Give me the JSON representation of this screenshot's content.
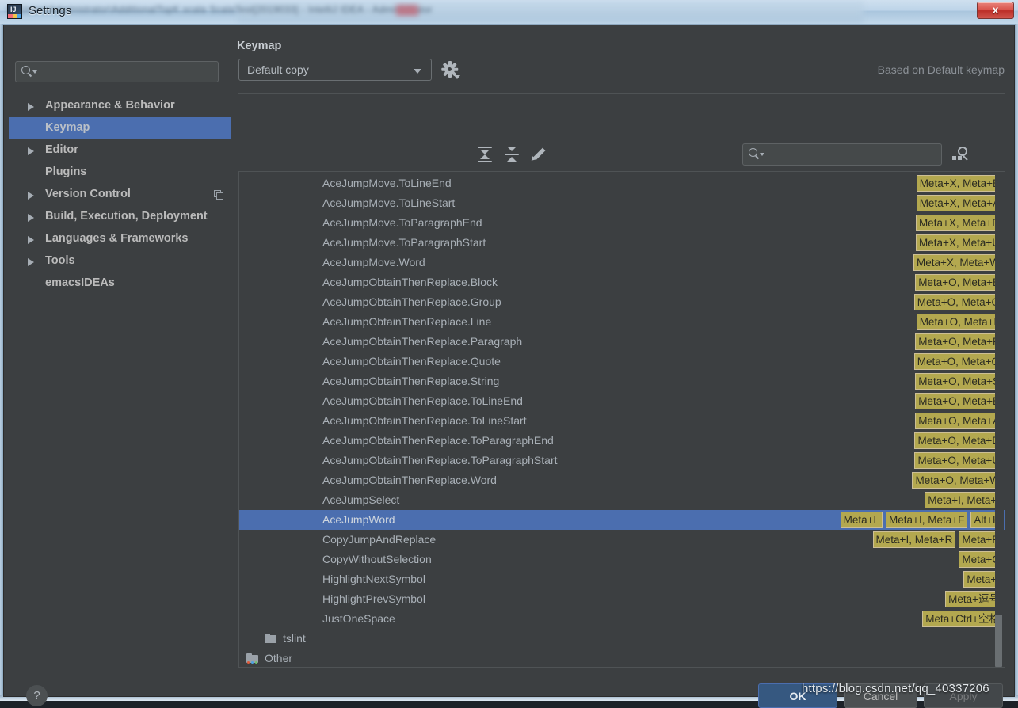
{
  "window": {
    "title": "Settings",
    "app_icon": "intellij-idea-icon",
    "blurred_title_text": "C:\\Users\\Administrator\\AdditionalTopK.scala ScalaTest[2019033] - IntelliJ IDEA - Administrator",
    "close_label": "x"
  },
  "sidebar": {
    "search_placeholder": "",
    "items": [
      {
        "label": "Appearance & Behavior",
        "expandable": true,
        "selected": false,
        "trailing_icon": ""
      },
      {
        "label": "Keymap",
        "expandable": false,
        "selected": true,
        "trailing_icon": ""
      },
      {
        "label": "Editor",
        "expandable": true,
        "selected": false,
        "trailing_icon": ""
      },
      {
        "label": "Plugins",
        "expandable": false,
        "selected": false,
        "trailing_icon": ""
      },
      {
        "label": "Version Control",
        "expandable": true,
        "selected": false,
        "trailing_icon": "copy-icon"
      },
      {
        "label": "Build, Execution, Deployment",
        "expandable": true,
        "selected": false,
        "trailing_icon": ""
      },
      {
        "label": "Languages & Frameworks",
        "expandable": true,
        "selected": false,
        "trailing_icon": ""
      },
      {
        "label": "Tools",
        "expandable": true,
        "selected": false,
        "trailing_icon": ""
      },
      {
        "label": "emacsIDEAs",
        "expandable": false,
        "selected": false,
        "trailing_icon": ""
      }
    ]
  },
  "main": {
    "title": "Keymap",
    "keymap_selected": "Default copy",
    "based_on": "Based on Default keymap",
    "search_placeholder": "",
    "toolbar": {
      "expand_all": "Expand All",
      "collapse_all": "Collapse All",
      "edit": "Edit Shortcut"
    },
    "rows": [
      {
        "name": "AceJumpMove.ToLineEnd",
        "indent": 105,
        "badges": [
          "Meta+X, Meta+E"
        ]
      },
      {
        "name": "AceJumpMove.ToLineStart",
        "indent": 105,
        "badges": [
          "Meta+X, Meta+A"
        ]
      },
      {
        "name": "AceJumpMove.ToParagraphEnd",
        "indent": 105,
        "badges": [
          "Meta+X, Meta+D"
        ]
      },
      {
        "name": "AceJumpMove.ToParagraphStart",
        "indent": 105,
        "badges": [
          "Meta+X, Meta+U"
        ]
      },
      {
        "name": "AceJumpMove.Word",
        "indent": 105,
        "badges": [
          "Meta+X, Meta+W"
        ]
      },
      {
        "name": "AceJumpObtainThenReplace.Block",
        "indent": 105,
        "badges": [
          "Meta+O, Meta+B"
        ]
      },
      {
        "name": "AceJumpObtainThenReplace.Group",
        "indent": 105,
        "badges": [
          "Meta+O, Meta+G"
        ]
      },
      {
        "name": "AceJumpObtainThenReplace.Line",
        "indent": 105,
        "badges": [
          "Meta+O, Meta+L"
        ]
      },
      {
        "name": "AceJumpObtainThenReplace.Paragraph",
        "indent": 105,
        "badges": [
          "Meta+O, Meta+P"
        ]
      },
      {
        "name": "AceJumpObtainThenReplace.Quote",
        "indent": 105,
        "badges": [
          "Meta+O, Meta+Q"
        ]
      },
      {
        "name": "AceJumpObtainThenReplace.String",
        "indent": 105,
        "badges": [
          "Meta+O, Meta+S"
        ]
      },
      {
        "name": "AceJumpObtainThenReplace.ToLineEnd",
        "indent": 105,
        "badges": [
          "Meta+O, Meta+E"
        ]
      },
      {
        "name": "AceJumpObtainThenReplace.ToLineStart",
        "indent": 105,
        "badges": [
          "Meta+O, Meta+A"
        ]
      },
      {
        "name": "AceJumpObtainThenReplace.ToParagraphEnd",
        "indent": 105,
        "badges": [
          "Meta+O, Meta+D"
        ]
      },
      {
        "name": "AceJumpObtainThenReplace.ToParagraphStart",
        "indent": 105,
        "badges": [
          "Meta+O, Meta+U"
        ]
      },
      {
        "name": "AceJumpObtainThenReplace.Word",
        "indent": 105,
        "badges": [
          "Meta+O, Meta+W"
        ]
      },
      {
        "name": "AceJumpSelect",
        "indent": 105,
        "badges": [
          "Meta+I, Meta+I"
        ]
      },
      {
        "name": "AceJumpWord",
        "indent": 105,
        "badges": [
          "Meta+L",
          "Meta+I, Meta+F",
          "Alt+K"
        ],
        "selected": true
      },
      {
        "name": "CopyJumpAndReplace",
        "indent": 105,
        "badges": [
          "Meta+I, Meta+R",
          "Meta+R"
        ]
      },
      {
        "name": "CopyWithoutSelection",
        "indent": 105,
        "badges": [
          "Meta+C"
        ]
      },
      {
        "name": "HighlightNextSymbol",
        "indent": 105,
        "badges": [
          "Meta+."
        ]
      },
      {
        "name": "HighlightPrevSymbol",
        "indent": 105,
        "badges": [
          "Meta+逗号"
        ]
      },
      {
        "name": "JustOneSpace",
        "indent": 105,
        "badges": [
          "Meta+Ctrl+空格"
        ]
      },
      {
        "name": "tslint",
        "indent": 55,
        "badges": [],
        "group": true,
        "icon": "folder-icon",
        "triangle_x": 33
      },
      {
        "name": "Other",
        "indent": 32,
        "badges": [],
        "group": true,
        "icon": "folder-other-icon",
        "triangle_x": 10
      }
    ]
  },
  "footer": {
    "help": "?",
    "ok": "OK",
    "cancel": "Cancel",
    "apply": "Apply"
  },
  "watermark": "https://blog.csdn.net/qq_40337206",
  "colors": {
    "selection": "#4b6eaf",
    "badge_bg": "#b3a84f",
    "badge_border": "#cdbf95",
    "panel_bg": "#3c3f41",
    "ok_button": "#365880"
  }
}
